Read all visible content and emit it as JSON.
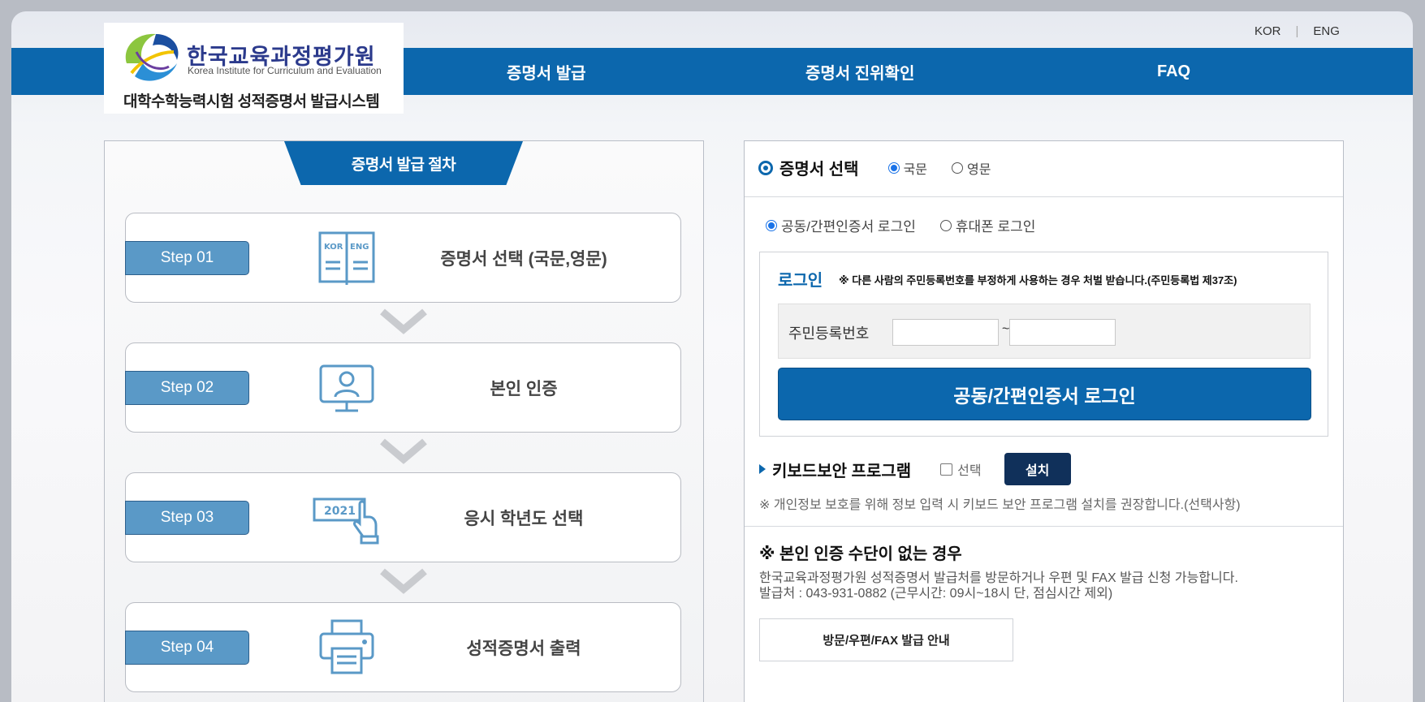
{
  "lang": {
    "kor": "KOR",
    "separator": "|",
    "eng": "ENG"
  },
  "logo": {
    "korean": "한국교육과정평가원",
    "english": "Korea Institute for Curriculum and Evaluation",
    "system": "대학수학능력시험 성적증명서 발급시스템"
  },
  "nav": {
    "issue": "증명서 발급",
    "verify": "증명서 진위확인",
    "faq": "FAQ"
  },
  "procedure": {
    "title": "증명서 발급 절차",
    "steps": [
      {
        "badge": "Step 01",
        "text": "증명서 선택 (국문,영문)",
        "icon": "book-kor-eng-icon"
      },
      {
        "badge": "Step 02",
        "text": "본인 인증",
        "icon": "monitor-user-icon"
      },
      {
        "badge": "Step 03",
        "text": "응시 학년도 선택",
        "icon": "year-click-icon"
      },
      {
        "badge": "Step 04",
        "text": "성적증명서 출력",
        "icon": "printer-icon"
      }
    ],
    "icon_labels": {
      "kor": "KOR",
      "eng": "ENG",
      "year": "2021"
    }
  },
  "certificate": {
    "title": "증명서 선택",
    "options": [
      {
        "label": "국문",
        "checked": true
      },
      {
        "label": "영문",
        "checked": false
      }
    ]
  },
  "login_mode": {
    "options": [
      {
        "label": "공동/간편인증서 로그인",
        "checked": true
      },
      {
        "label": "휴대폰 로그인",
        "checked": false
      }
    ]
  },
  "login": {
    "title": "로그인",
    "warning": "※ 다른 사람의 주민등록번호를 부정하게 사용하는 경우 처벌 받습니다.(주민등록법 제37조)",
    "rrn_label": "주민등록번호",
    "rrn_front": "",
    "rrn_back": "",
    "tilde": "~",
    "button": "공동/간편인증서 로그인"
  },
  "keyboard": {
    "title": "키보드보안 프로그램",
    "check_label": "선택",
    "install_button": "설치",
    "note": "※ 개인정보 보호를 위해 정보 입력 시 키보드 보안 프로그램 설치를 권장합니다.(선택사항)"
  },
  "no_auth": {
    "title": "※ 본인 인증 수단이 없는 경우",
    "line1": "한국교육과정평가원 성적증명서 발급처를 방문하거나 우편 및 FAX 발급 신청 가능합니다.",
    "line2": "발급처 : 043-931-0882 (근무시간: 09시~18시 단, 점심시간 제외)",
    "button": "방문/우편/FAX 발급 안내"
  },
  "colors": {
    "brand_blue": "#0c67ad",
    "step_badge": "#5a99c7",
    "install_btn": "#10305a"
  }
}
